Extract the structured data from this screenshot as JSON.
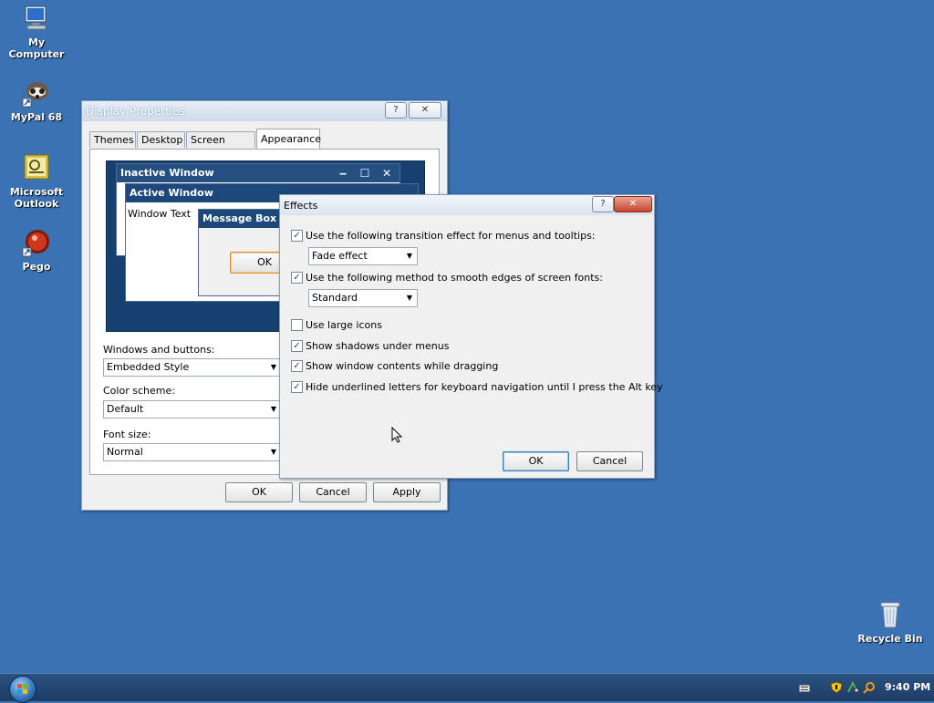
{
  "desktop": {
    "icons": [
      {
        "label": "My Computer",
        "icon": "computer-icon"
      },
      {
        "label": "MyPal 68",
        "icon": "raccoon-browser-icon"
      },
      {
        "label": "Microsoft Outlook",
        "icon": "outlook-icon"
      },
      {
        "label": "Pego",
        "icon": "pego-icon"
      },
      {
        "label": "Recycle Bin",
        "icon": "recycle-bin-icon"
      }
    ]
  },
  "display_properties": {
    "title": "Display Properties",
    "help_glyph": "?",
    "close_glyph": "✕",
    "tabs": [
      "Themes",
      "Desktop",
      "Screen Saver",
      "Appearance"
    ],
    "preview": {
      "inactive_title": "Inactive Window",
      "active_title": "Active Window",
      "window_text": "Window Text",
      "message_box_title": "Message Box",
      "ok_label": "OK"
    },
    "windows_buttons_label": "Windows and buttons:",
    "windows_buttons_value": "Embedded Style",
    "color_scheme_label": "Color scheme:",
    "color_scheme_value": "Default",
    "font_size_label": "Font size:",
    "font_size_value": "Normal",
    "ok_label": "OK",
    "cancel_label": "Cancel",
    "apply_label": "Apply"
  },
  "effects": {
    "title": "Effects",
    "help_glyph": "?",
    "close_glyph": "✕",
    "transition_label": "Use the following transition effect for menus and tooltips:",
    "transition_checked": true,
    "transition_value": "Fade effect",
    "smooth_label": "Use the following method to smooth edges of screen fonts:",
    "smooth_checked": true,
    "smooth_value": "Standard",
    "large_icons_label": "Use large icons",
    "large_icons_checked": false,
    "shadows_label": "Show shadows under menus",
    "shadows_checked": true,
    "drag_label": "Show window contents while dragging",
    "drag_checked": true,
    "underline_label": "Hide underlined letters for keyboard navigation until I press the Alt key",
    "underline_checked": true,
    "ok_label": "OK",
    "cancel_label": "Cancel"
  },
  "taskbar": {
    "clock": "9:40 PM"
  },
  "colors": {
    "desktop": "#3a72b4",
    "preview_bg": "#16406f",
    "title_active": "#1c4979"
  }
}
